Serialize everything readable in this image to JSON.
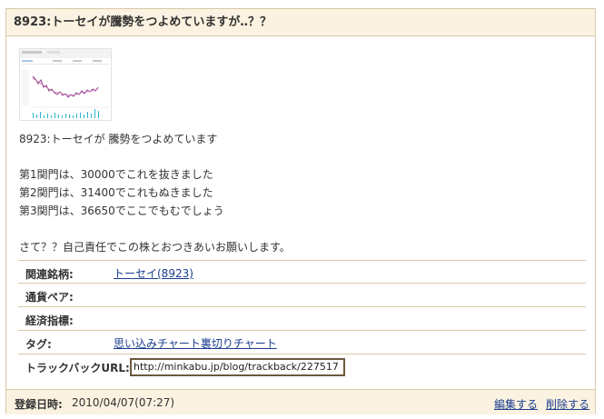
{
  "entry": {
    "title": "8923:トーセイが騰勢をつよめていますが‥？？",
    "body_lines": [
      "8923:トーセイが 騰勢をつよめています",
      "第1関門は、30000でこれを抜きました",
      "第2関門は、31400でこれもぬきました",
      "第3関門は、36650でここでもむでしょう",
      "さて？？自己責任でこの株とおつきあいお願いします。"
    ]
  },
  "meta": {
    "related_label": "関連銘柄:",
    "related_value": "トーセイ(8923)",
    "currency_label": "通貨ペア:",
    "indicator_label": "経済指標:",
    "tag_label": "タグ:",
    "tag_value": "思い込みチャート裏切りチャート",
    "trackback_label": "トラックバックURL:",
    "trackback_url": "http://minkabu.jp/blog/trackback/227517"
  },
  "footer": {
    "date_label": "登録日時:",
    "date_value": "2010/04/07(07:27)",
    "edit_label": "編集する",
    "delete_label": "削除する"
  },
  "colors": {
    "border": "#d9c9a6",
    "header_bg": "#fbf2e1",
    "link": "#1a3d8f",
    "chart_price_line": "#8a3a8f",
    "chart_volume": "#2bb3c9"
  },
  "icons": [
    "stock-chart-thumbnail"
  ]
}
